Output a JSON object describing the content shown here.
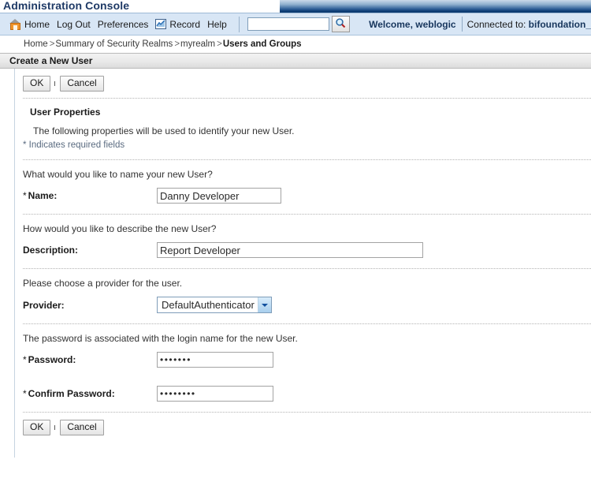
{
  "app": {
    "title": "Administration Console"
  },
  "menubar": {
    "home_icon": "home-icon",
    "items": [
      {
        "label": "Home",
        "name": "menu-home"
      },
      {
        "label": "Log Out",
        "name": "menu-log-out"
      },
      {
        "label": "Preferences",
        "name": "menu-preferences"
      },
      {
        "label": "Record",
        "name": "menu-record"
      },
      {
        "label": "Help",
        "name": "menu-help"
      }
    ],
    "record_icon": "chart-icon",
    "search": {
      "value": "",
      "placeholder": "",
      "button_icon": "search-icon"
    },
    "welcome": "Welcome, weblogic",
    "connected_label": "Connected to:",
    "connected_value": "bifoundation_"
  },
  "breadcrumb": {
    "items": [
      {
        "label": "Home",
        "current": false
      },
      {
        "label": "Summary of Security Realms",
        "current": false
      },
      {
        "label": "myrealm",
        "current": false
      },
      {
        "label": "Users and Groups",
        "current": true
      }
    ],
    "separator": ">"
  },
  "page": {
    "title": "Create a New User"
  },
  "toolbar_top": {
    "ok_label": "OK",
    "cancel_label": "Cancel"
  },
  "toolbar_bottom": {
    "ok_label": "OK",
    "cancel_label": "Cancel"
  },
  "form": {
    "section_heading": "User Properties",
    "section_description": "The following properties will be used to identify your new User.",
    "required_note": "* Indicates required fields",
    "name_question": "What would you like to name your new User?",
    "name_label_star": "*",
    "name_label": "Name:",
    "name_value": "Danny Developer",
    "description_question": "How would you like to describe the new User?",
    "description_label": "Description:",
    "description_value": "Report Developer",
    "provider_question": "Please choose a provider for the user.",
    "provider_label": "Provider:",
    "provider_value": "DefaultAuthenticator",
    "provider_options": [
      "DefaultAuthenticator"
    ],
    "password_question": "The password is associated with the login name for the new User.",
    "password_label_star": "*",
    "password_label": "Password:",
    "password_value": "•••••••",
    "confirm_label_star": "*",
    "confirm_label": "Confirm Password:",
    "confirm_value": "••••••••"
  },
  "colors": {
    "banner_dark": "#0b396e",
    "menubar_bg": "#d8e6f5",
    "title_blue": "#1f3a66",
    "accent_orange": "#f0942a"
  }
}
